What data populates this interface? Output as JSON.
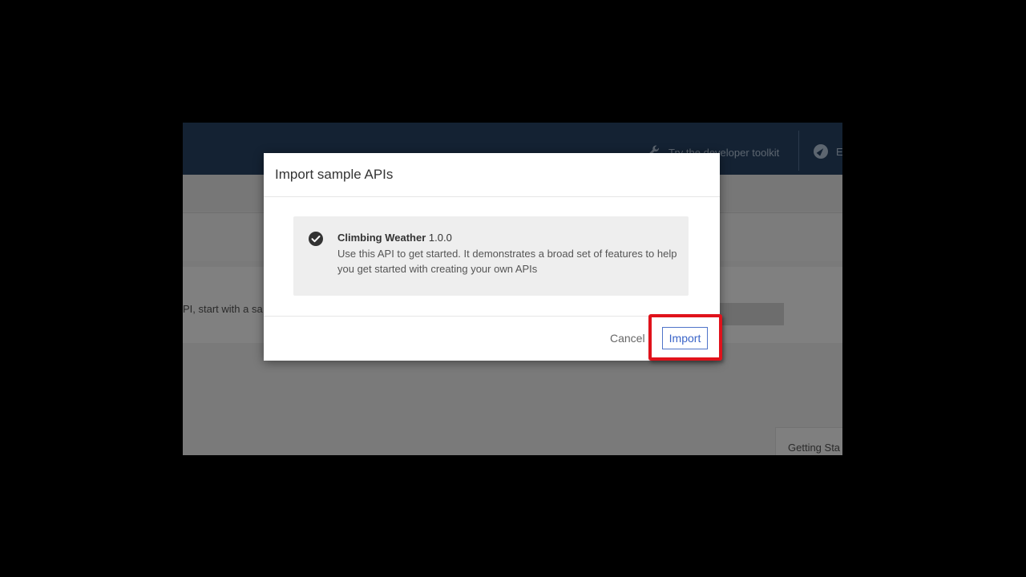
{
  "background": {
    "topbar": {
      "toolkit_link": "Try the developer toolkit",
      "explore_link_partial": "E"
    },
    "card_text_partial": "PI, start with a sa",
    "getting_started_partial": "Getting Sta"
  },
  "dialog": {
    "title": "Import sample APIs",
    "item": {
      "name": "Climbing Weather",
      "version": "1.0.0",
      "description": "Use this API to get started. It demonstrates a broad set of features to help you get started with creating your own APIs",
      "selected": true
    },
    "cancel_label": "Cancel",
    "import_label": "Import"
  },
  "colors": {
    "highlight": "#e0121b",
    "accent": "#3a64c8",
    "topbar": "#142233"
  },
  "icons": [
    "wrench-icon",
    "compass-icon",
    "check-circle-icon"
  ]
}
